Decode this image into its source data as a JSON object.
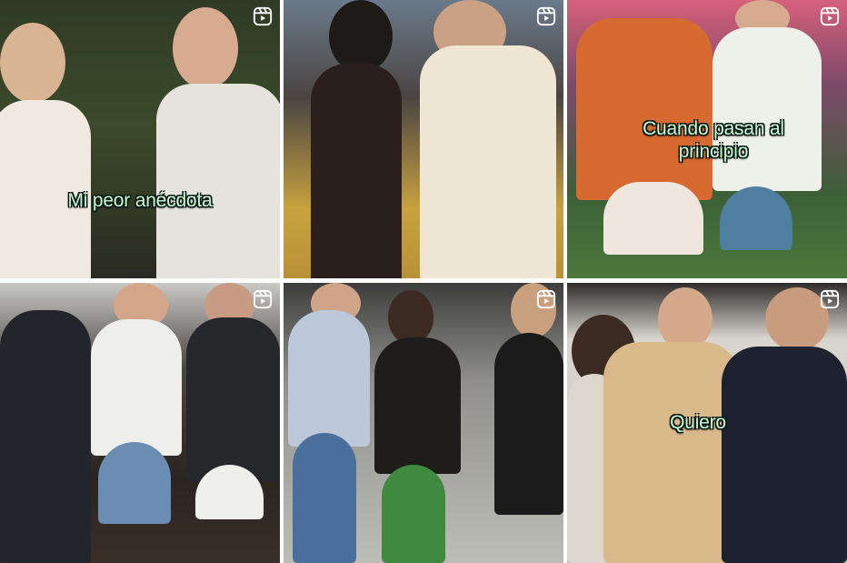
{
  "grid": {
    "tiles": [
      {
        "id": "reel-1",
        "caption": "Mi peor anécdota",
        "icon": "reels-icon",
        "palette": {
          "bg": "#2e3a24",
          "accent": "#e8e6df"
        }
      },
      {
        "id": "reel-2",
        "caption": "",
        "icon": "reels-icon",
        "palette": {
          "bg": "#3a3330",
          "accent": "#f1ead9"
        }
      },
      {
        "id": "reel-3",
        "caption": "Cuando pasan al principio",
        "icon": "reels-icon",
        "palette": {
          "bg": "#3f6b3a",
          "accent": "#e47b3a"
        }
      },
      {
        "id": "reel-4",
        "caption": "",
        "icon": "reels-icon",
        "palette": {
          "bg": "#2b2622",
          "accent": "#f2f0ec"
        }
      },
      {
        "id": "reel-5",
        "caption": "",
        "icon": "reels-icon",
        "palette": {
          "bg": "#8a8a86",
          "accent": "#1c1c1c"
        }
      },
      {
        "id": "reel-6",
        "caption": "Quiero",
        "icon": "reels-icon",
        "palette": {
          "bg": "#d9d6cf",
          "accent": "#d8b98a"
        }
      }
    ]
  },
  "colors": {
    "caption_text": "#c9f7d4",
    "caption_outline": "#0b1a14"
  }
}
